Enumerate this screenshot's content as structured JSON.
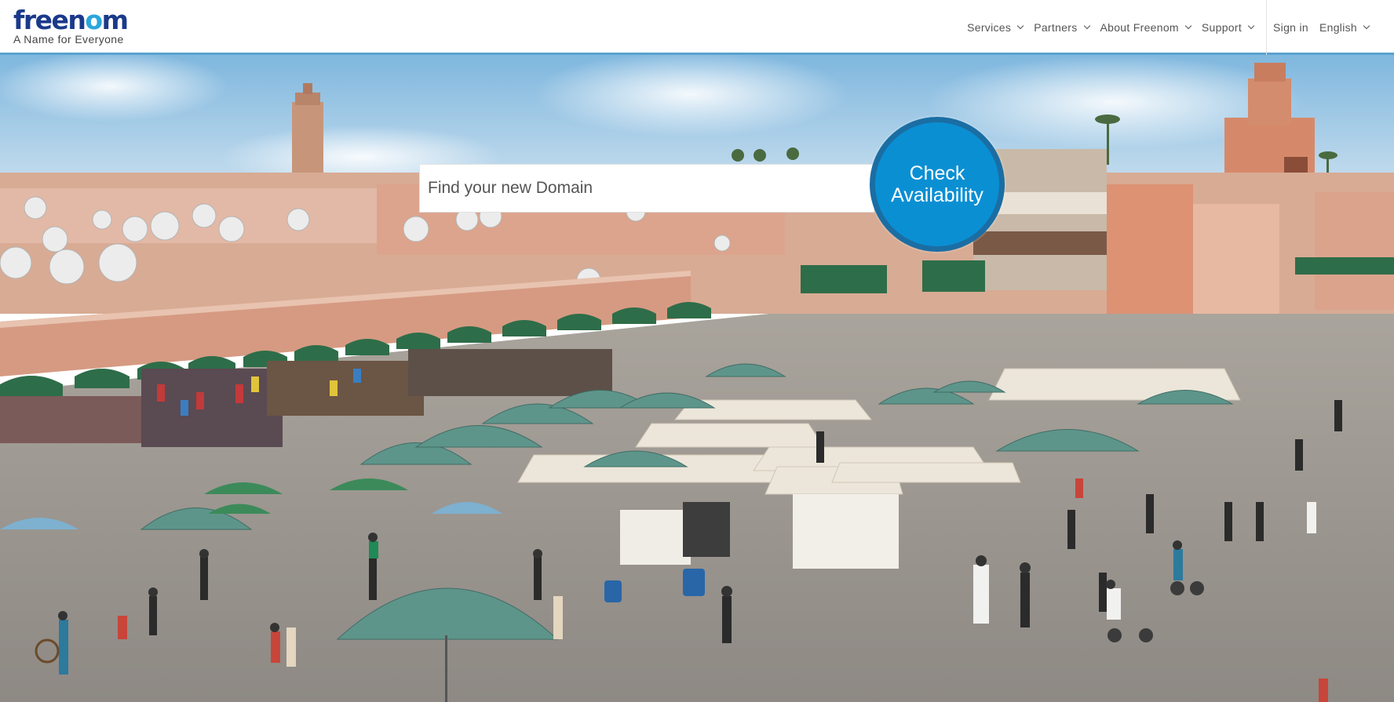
{
  "brand": {
    "logo_prefix": "free",
    "logo_o": "o",
    "logo_suffix_start": "n",
    "logo_suffix_end": "m",
    "tagline": "A Name for Everyone"
  },
  "nav": {
    "services": "Services",
    "partners": "Partners",
    "about": "About Freenom",
    "support": "Support",
    "sign_in": "Sign in",
    "language": "English"
  },
  "search": {
    "placeholder": "Find your new Domain",
    "value": ""
  },
  "check_button": {
    "line1": "Check",
    "line2": "Availability"
  },
  "colors": {
    "accent": "#0b8fd3",
    "accent_border": "#1a6ea3",
    "logo_dark": "#1a3a8a",
    "logo_light": "#2aa7dc",
    "header_rule": "#5aa2cf"
  },
  "hero": {
    "image_description_icon": "marketplace-photo"
  }
}
